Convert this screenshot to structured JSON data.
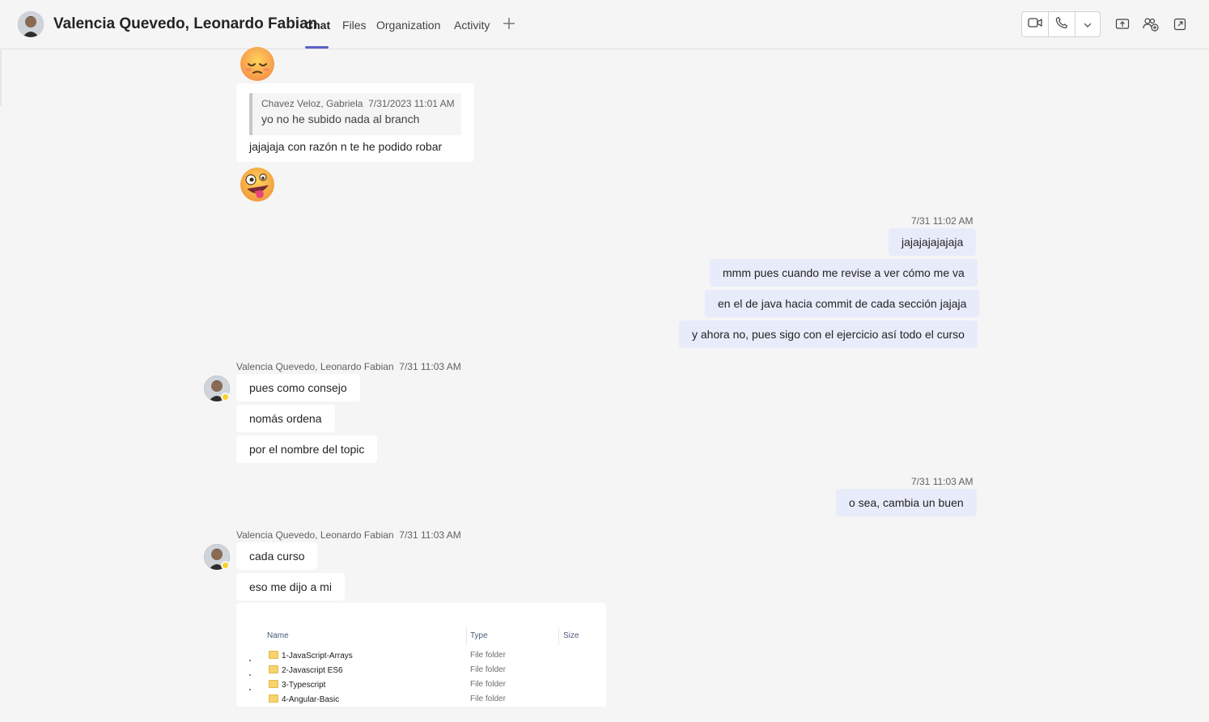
{
  "header": {
    "contact_name": "Valencia Quevedo, Leonardo Fabian",
    "tabs": [
      {
        "label": "Chat",
        "active": true
      },
      {
        "label": "Files",
        "active": false
      },
      {
        "label": "Organization",
        "active": false
      },
      {
        "label": "Activity",
        "active": false
      }
    ],
    "accent_color": "#5b5fc7",
    "icons": [
      "add-tab-icon",
      "video-call-icon",
      "phone-call-icon",
      "chevron-down-icon",
      "share-screen-icon",
      "add-people-icon",
      "pop-out-icon"
    ]
  },
  "messages": {
    "reaction_emoji_1": "pensive-face",
    "quote": {
      "author": "Chavez Veloz, Gabriela",
      "time": "7/31/2023 11:01 AM",
      "text": "yo no he subido nada al branch",
      "reply": "jajajaja con razón n te he podido robar"
    },
    "reaction_emoji_2": "zany-face",
    "mine_1": {
      "time": "7/31 11:02 AM",
      "lines": [
        "jajajajajajaja",
        "mmm pues cuando me revise a ver cómo me va",
        "en el de java hacia commit de cada sección jajaja",
        "y ahora no, pues sigo con el ejercicio así todo el curso"
      ]
    },
    "theirs_1": {
      "author": "Valencia Quevedo, Leonardo Fabian",
      "time": "7/31 11:03 AM",
      "lines": [
        "pues como consejo",
        "nomás ordena",
        "por el nombre del topic"
      ]
    },
    "mine_2": {
      "time": "7/31 11:03 AM",
      "lines": [
        "o sea, cambia un buen"
      ]
    },
    "theirs_2": {
      "author": "Valencia Quevedo, Leonardo Fabian",
      "time": "7/31 11:03 AM",
      "lines": [
        "cada curso",
        "eso me dijo a mi"
      ]
    },
    "screenshot": {
      "columns": [
        "Name",
        "Type",
        "Size"
      ],
      "rows": [
        {
          "name": "1-JavaScript-Arrays",
          "type": "File folder"
        },
        {
          "name": "2-Javascript ES6",
          "type": "File folder"
        },
        {
          "name": "3-Typescript",
          "type": "File folder"
        },
        {
          "name": "4-Angular-Basic",
          "type": "File folder"
        }
      ]
    }
  },
  "colors": {
    "background": "#f5f5f5",
    "own_bubble": "#e8ebfa",
    "other_bubble": "#ffffff",
    "presence_away": "#f8d22a"
  }
}
